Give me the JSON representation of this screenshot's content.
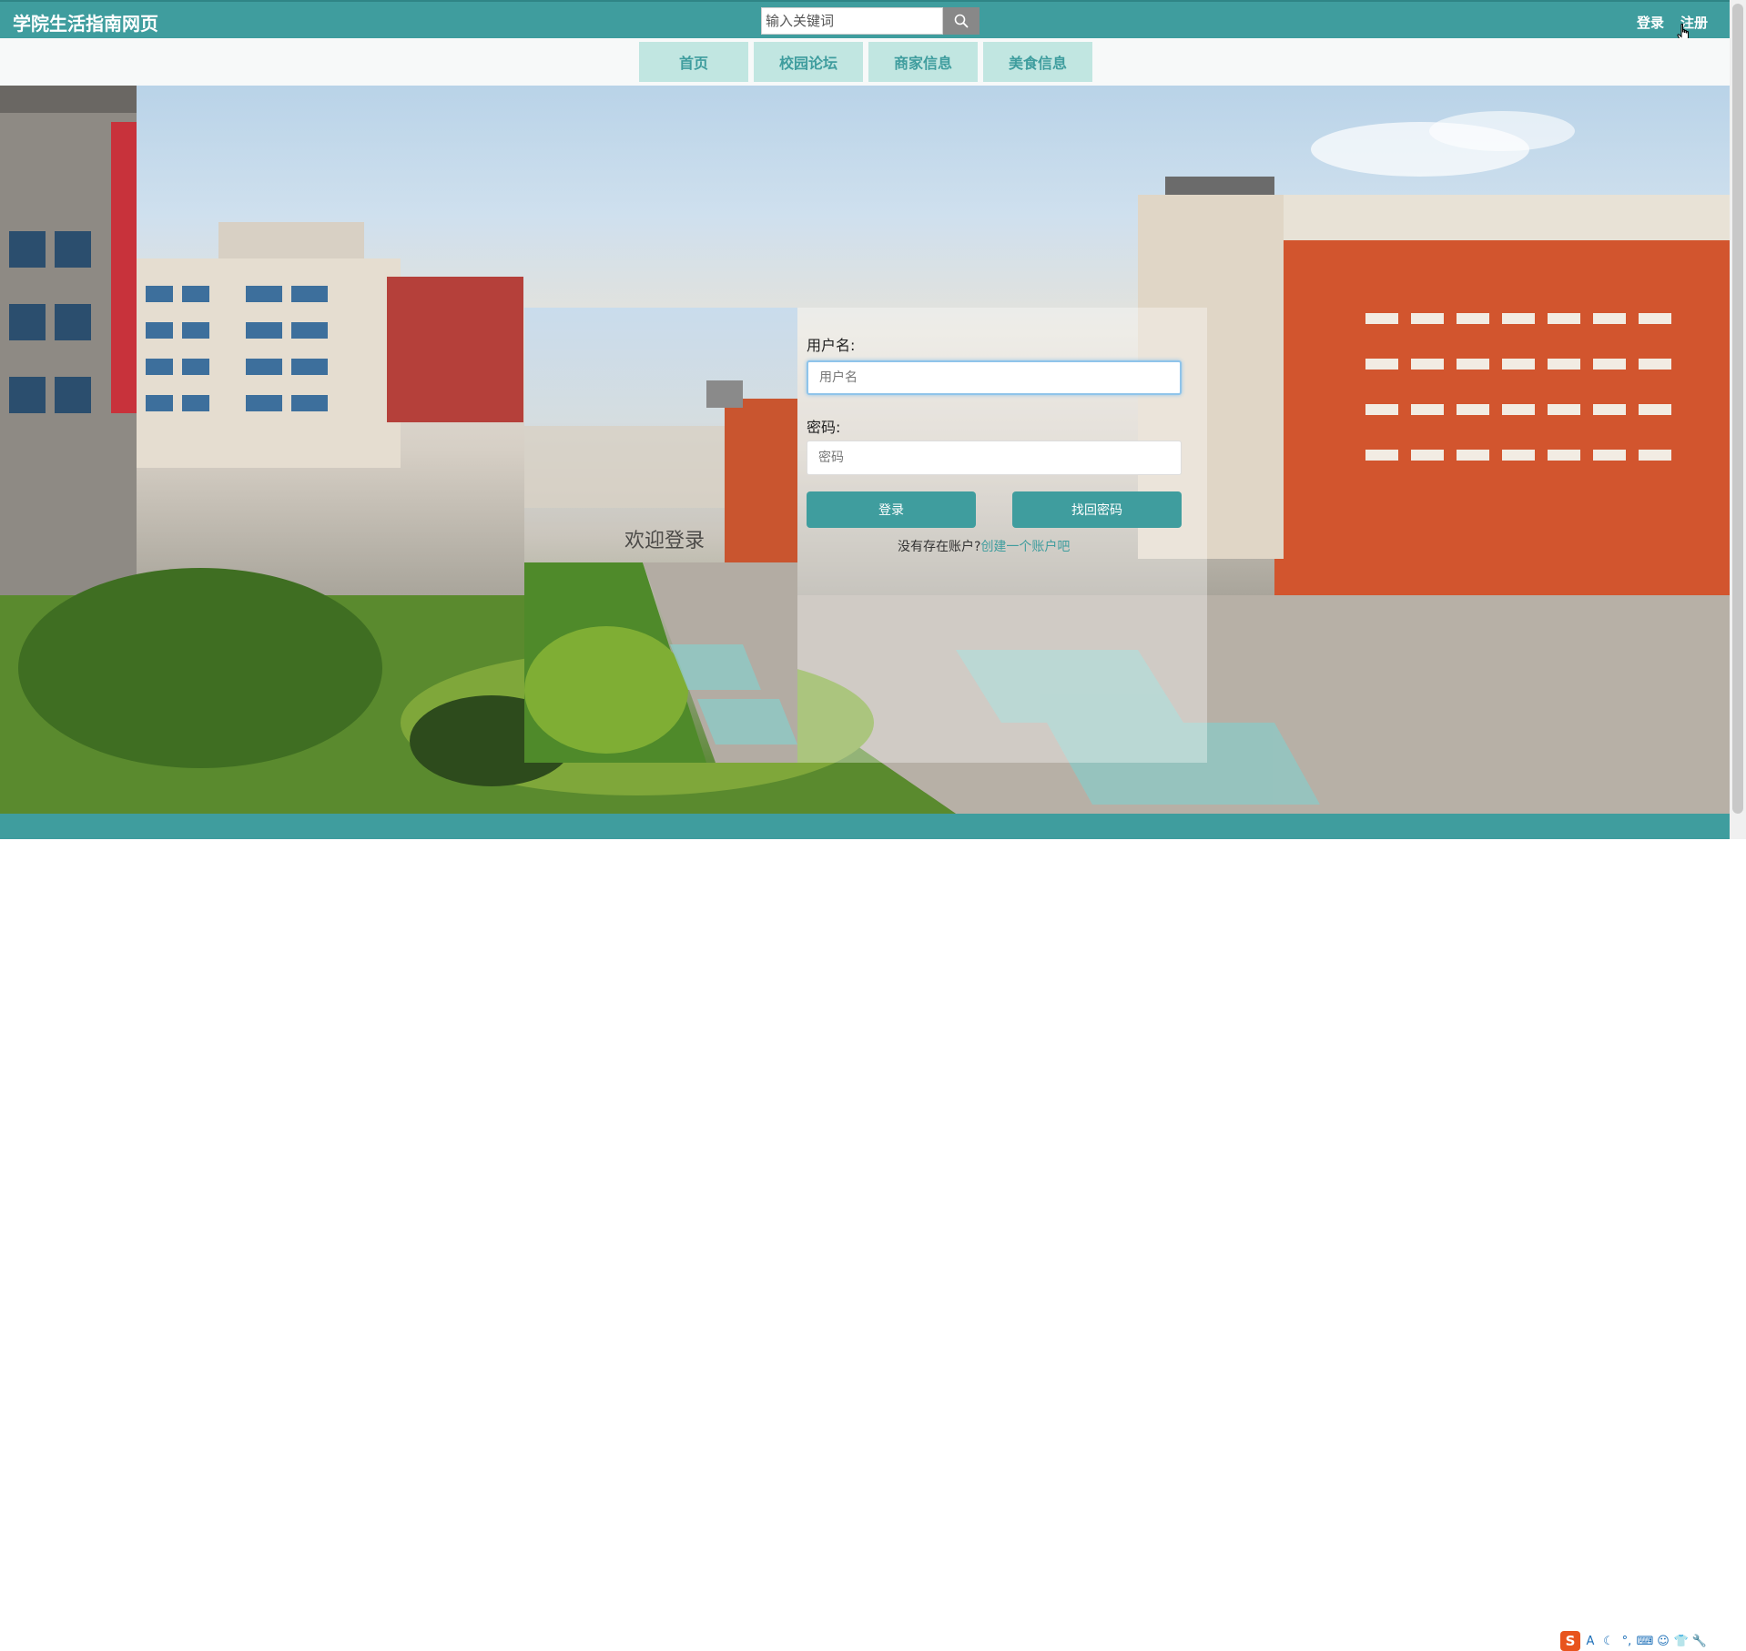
{
  "header": {
    "site_title": "学院生活指南网页",
    "search_placeholder": "输入关键词",
    "login_label": "登录",
    "register_label": "注册"
  },
  "nav": {
    "items": [
      {
        "label": "首页"
      },
      {
        "label": "校园论坛"
      },
      {
        "label": "商家信息"
      },
      {
        "label": "美食信息"
      }
    ]
  },
  "login": {
    "welcome_text": "欢迎登录",
    "username_label": "用户名:",
    "username_placeholder": "用户名",
    "password_label": "密码:",
    "password_placeholder": "密码",
    "login_button": "登录",
    "forgot_button": "找回密码",
    "no_account_text": "没有存在账户?",
    "create_account_link": "创建一个账户吧"
  },
  "ime": {
    "logo": "S",
    "icons": [
      "A",
      "☾",
      "°,",
      "⌨",
      "☺",
      "👕",
      "🔧"
    ]
  },
  "colors": {
    "accent": "#3f9d9e",
    "nav_bg": "#c1e6e1"
  }
}
